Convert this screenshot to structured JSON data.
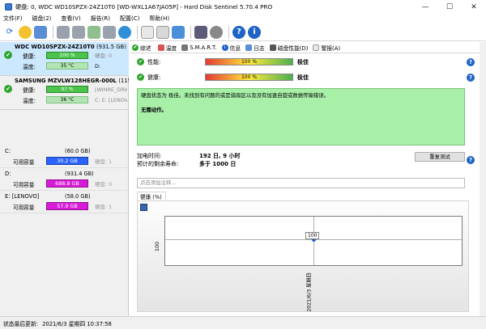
{
  "window": {
    "title": "硬盘: 0, WDC WD10SPZX-24Z10T0 [WD-WXL1A67JA05P]  -  Hard Disk Sentinel 5.70.4 PRO",
    "minimize": "—",
    "maximize": "☐",
    "close": "✕"
  },
  "menu": [
    "文件(F)",
    "磁盘(2)",
    "查看(V)",
    "报告(R)",
    "配置(C)",
    "帮助(H)"
  ],
  "toolbar_icons": [
    "refresh-icon",
    "disk-info-icon",
    "report-icon",
    "drive-1-icon",
    "drive-2-icon",
    "drive-3-icon",
    "drive-4-icon",
    "globe-icon",
    "document-icon",
    "copy-icon",
    "monitor-icon",
    "screen-icon",
    "settings-icon",
    "help-icon",
    "info-icon"
  ],
  "disks": [
    {
      "name": "WDC WD10SPZX-24Z10T0",
      "size": "(931.5 GB)",
      "health_label": "健康:",
      "health": "100 %",
      "health_pct": 100,
      "health_extra": "硬盘: 0",
      "temp_label": "温度:",
      "temp": "35 °C",
      "temp_extra": "D:"
    },
    {
      "name": "SAMSUNG MZVLW128HEGR-000L",
      "size": "(119.2 G",
      "health_label": "健康:",
      "health": "97 %",
      "health_pct": 97,
      "health_extra": "[WINRE_DRV",
      "temp_label": "温度:",
      "temp": "36 °C",
      "temp_extra": "C: E: [LENOV"
    }
  ],
  "volumes": [
    {
      "name": "C:",
      "size": "(60.0 GB)",
      "free_label": "可用容量",
      "free": "30.2 GB",
      "free_pct": 50,
      "extra": "硬盘: 1"
    },
    {
      "name": "D:",
      "size": "(931.4 GB)",
      "free_label": "可用容量",
      "free": "688.8 GB",
      "free_pct": 74,
      "extra": "硬盘: 0"
    },
    {
      "name": "E: [LENOVO]",
      "size": "(58.0 GB)",
      "free_label": "可用容量",
      "free": "57.9 GB",
      "free_pct": 99,
      "extra": "硬盘: 1"
    }
  ],
  "tabs": [
    "综述",
    "温度",
    "S.M.A.R.T.",
    "信息",
    "日志",
    "磁盘性能(D)",
    "警报(A)"
  ],
  "tab_icons": [
    "check-icon",
    "thermometer-icon",
    "smart-icon",
    "info-icon",
    "log-icon",
    "performance-icon",
    "alert-icon"
  ],
  "metrics": [
    {
      "label": "性能:",
      "value": "100 %",
      "pct": 100,
      "verdict": "极佳"
    },
    {
      "label": "健康:",
      "value": "100 %",
      "pct": 100,
      "verdict": "极佳"
    }
  ],
  "status_message": {
    "line1": "硬盘状态为 极佳。未找到有问题的或是弱扇区以及没有加速自旋或数据传输错误。",
    "line2": "无需动作。"
  },
  "power_on": {
    "label": "加电时间:",
    "value": "192 日, 9 小时"
  },
  "remaining": {
    "label": "预计的剩余寿命:",
    "value": "多于 1000 日"
  },
  "retest_button": "重复测试",
  "note_placeholder": "点击添加注释...",
  "graph_tab": "健康 (%)",
  "chart_data": {
    "type": "line",
    "title": "",
    "series": [
      {
        "name": "健康 (%)",
        "values": [
          100
        ]
      }
    ],
    "x": [
      "2021/6/3 星期四"
    ],
    "ylabel": "",
    "xlabel": "",
    "ytick": "100",
    "data_label": "100"
  },
  "status_bar": {
    "label": "状态最后更新:",
    "value": "2021/6/3 星期四 10:37:58"
  },
  "colors": {
    "selected_disk_bg": "#cce8ff",
    "health_bar": "#4cc34c",
    "volume_bar_blue": "#2962ff",
    "volume_bar_magenta": "#d81bd8",
    "status_box": "#a8f0a8"
  }
}
